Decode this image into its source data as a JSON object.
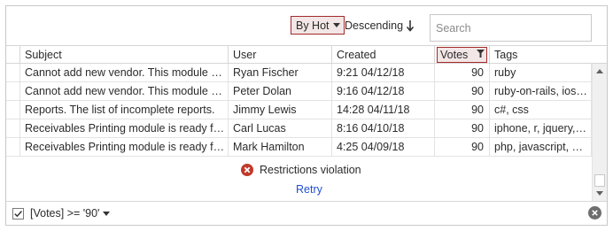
{
  "toolbar": {
    "sort_by_label": "By Hot",
    "sort_order_label": "Descending",
    "search_placeholder": "Search"
  },
  "columns": [
    "Subject",
    "User",
    "Created",
    "Votes",
    "Tags"
  ],
  "rows": [
    {
      "subject": "Cannot add new vendor. This module doesn't work!",
      "user": "Ryan Fischer",
      "created": "9:21 04/12/18",
      "votes": "90",
      "tags": "ruby"
    },
    {
      "subject": "Cannot add new vendor. This module doesn't work!",
      "user": "Peter Dolan",
      "created": "9:16 04/12/18",
      "votes": "90",
      "tags": "ruby-on-rails, ios, java"
    },
    {
      "subject": "Reports. The list of incomplete reports.",
      "user": "Jimmy Lewis",
      "created": "14:28 04/11/18",
      "votes": "90",
      "tags": "c#, css"
    },
    {
      "subject": "Receivables Printing module is ready for testing.",
      "user": "Carl Lucas",
      "created": "8:16 04/10/18",
      "votes": "90",
      "tags": "iphone, r, jquery, rails"
    },
    {
      "subject": "Receivables Printing module is ready for testing.",
      "user": "Mark Hamilton",
      "created": "4:25 04/09/18",
      "votes": "90",
      "tags": "php, javascript, html"
    }
  ],
  "error": {
    "message": "Restrictions violation",
    "retry_label": "Retry"
  },
  "filter_panel": {
    "checked": true,
    "expression": "[Votes] >= '90'"
  },
  "colors": {
    "accent_border": "#a52a2a",
    "accent_fill": "#f3e6e6",
    "error_icon": "#c0392b",
    "link": "#1f4fd1"
  }
}
